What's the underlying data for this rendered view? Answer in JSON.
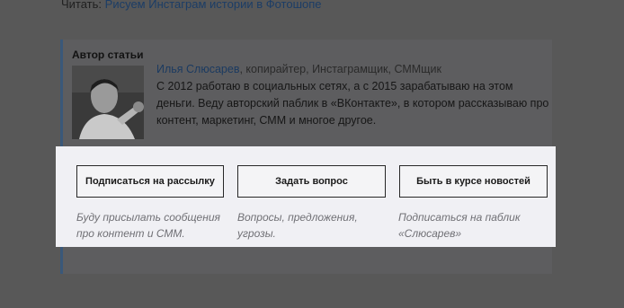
{
  "read_line": {
    "prefix": "Читать:",
    "link": "Рисуем Инстаграм истории в Фотошопе"
  },
  "author_card": {
    "title": "Автор статьи",
    "name": "Илья Слюсарев",
    "roles": ", копирайтер, Инстаграмщик, СММщик",
    "bio": "С 2012 работаю в социальных сетях, а с 2015 зарабатываю на этом деньги. Веду авторский паблик в «ВКонтакте», в котором рассказываю про контент, маркетинг, СММ и многое другое."
  },
  "actions": [
    {
      "button": "Подписаться на рассылку",
      "description": "Буду присылать сообщения про контент и СММ."
    },
    {
      "button": "Задать вопрос",
      "description": "Вопросы, предложения, угрозы."
    },
    {
      "button": "Быть в курсе новостей",
      "description": "Подписаться на паблик «Слюсарев»"
    }
  ],
  "colors": {
    "dimmed_background": "#585858",
    "link": "#1c3d66",
    "card_accent": "#3a5879",
    "highlight_panel": "#f0f0f4",
    "description_text": "#707075"
  }
}
